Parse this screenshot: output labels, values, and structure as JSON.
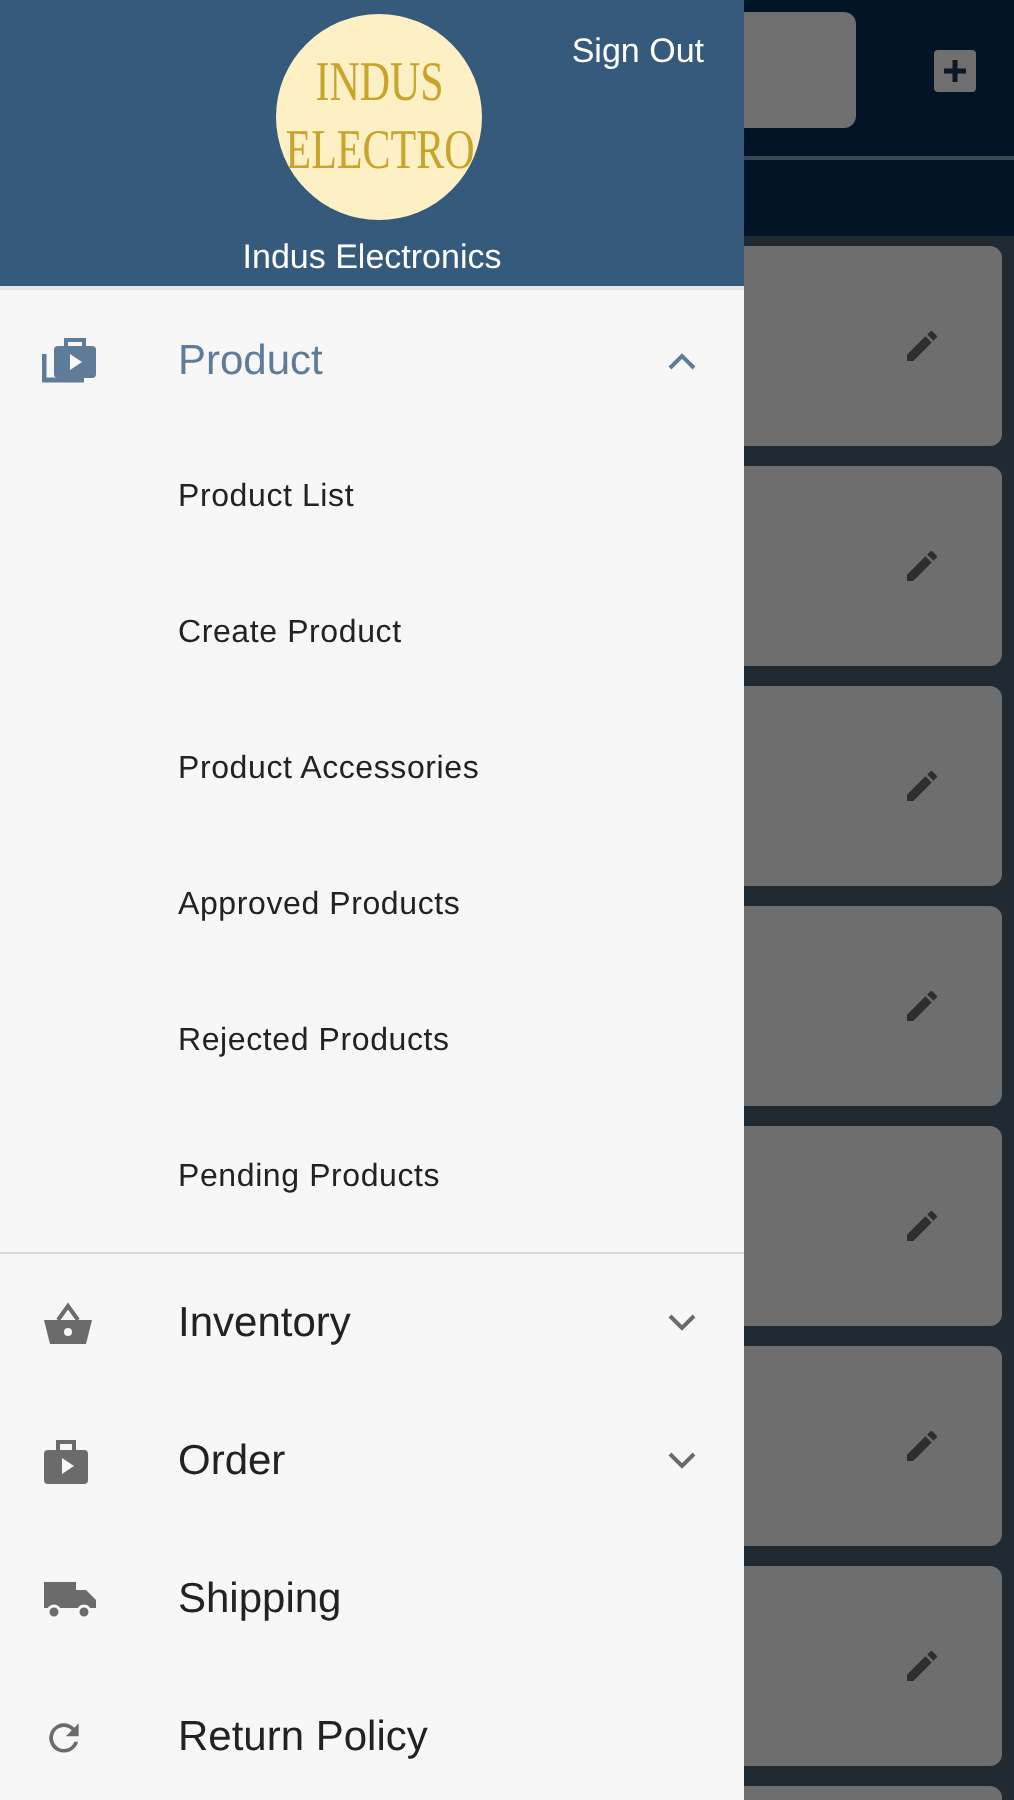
{
  "drawer_header": {
    "logo_lines": [
      "INDUS",
      "ELECTRO"
    ],
    "company_name": "Indus Electronics",
    "sign_out": "Sign Out"
  },
  "menu": [
    {
      "label": "Product",
      "kind": "group",
      "expanded": true,
      "children": [
        {
          "label": "Product List"
        },
        {
          "label": "Create Product"
        },
        {
          "label": "Product Accessories"
        },
        {
          "label": "Approved Products"
        },
        {
          "label": "Rejected Products"
        },
        {
          "label": "Pending Products"
        }
      ]
    },
    {
      "label": "Inventory",
      "kind": "group",
      "expanded": false
    },
    {
      "label": "Order",
      "kind": "group",
      "expanded": false
    },
    {
      "label": "Shipping",
      "kind": "link"
    },
    {
      "label": "Return Policy",
      "kind": "link"
    }
  ]
}
